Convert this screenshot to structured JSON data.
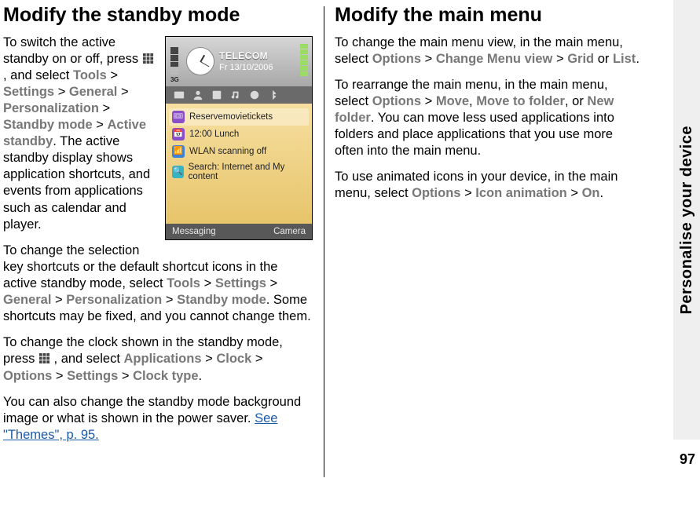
{
  "sideTab": "Personalise your device",
  "pageNumber": "97",
  "left": {
    "heading": "Modify the standby mode",
    "p1_a": "To switch the active standby on or off, press ",
    "p1_b": " , and select ",
    "p1_path": [
      "Tools",
      "Settings",
      "General",
      "Personalization",
      "Standby mode",
      "Active standby"
    ],
    "p1_c": ".  The active standby display shows application shortcuts, and events from applications such as calendar and player.",
    "p2_a": "To change the selection key shortcuts or the default shortcut icons in the active standby mode, select ",
    "p2_path": [
      "Tools",
      "Settings",
      "General",
      "Personalization",
      "Standby mode"
    ],
    "p2_b": ". Some shortcuts may be fixed, and you cannot change them.",
    "p3_a": "To change the clock shown in the standby mode, press ",
    "p3_b": " , and select ",
    "p3_path": [
      "Applications",
      "Clock",
      "Options",
      "Settings",
      "Clock type"
    ],
    "p3_c": ".",
    "p4_a": "You can also change the standby mode background image or what is shown in the power saver. ",
    "p4_link": "See \"Themes\", p. 95."
  },
  "right": {
    "heading": "Modify the main menu",
    "p1_a": "To change the main menu view, in the main menu, select ",
    "p1_opt": "Options",
    "p1_cmv": "Change Menu view",
    "p1_grid": "Grid",
    "p1_or": " or ",
    "p1_list": "List",
    "p1_end": ".",
    "p2_a": "To rearrange the main menu, in the main menu, select ",
    "p2_opt": "Options",
    "p2_move": "Move",
    "p2_mtf": "Move to folder",
    "p2_or": ", or ",
    "p2_nf": "New folder",
    "p2_b": ". You can move less used applications into folders and place applications that you use more often into the main menu.",
    "p3_a": "To use animated icons in your device, in the main menu, select ",
    "p3_opt": "Options",
    "p3_ia": "Icon animation",
    "p3_on": "On",
    "p3_end": "."
  },
  "phone": {
    "carrier": "TELECOM",
    "date": "Fr 13/10/2006",
    "rows": [
      {
        "label": "Reservemovietickets"
      },
      {
        "label": "12:00 Lunch"
      },
      {
        "label": "WLAN scanning off"
      },
      {
        "label": "Search: Internet and My content"
      }
    ],
    "softLeft": "Messaging",
    "softRight": "Camera"
  }
}
